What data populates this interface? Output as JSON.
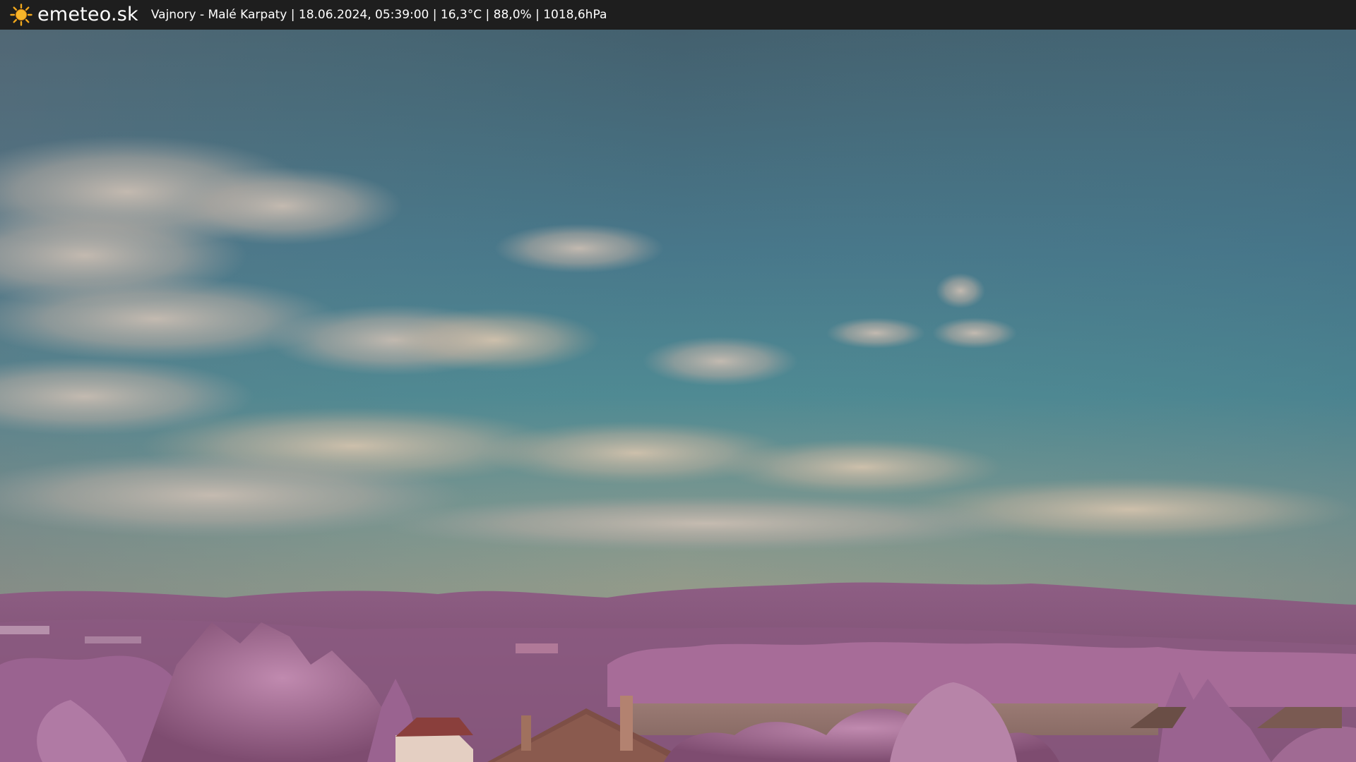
{
  "header": {
    "brand": "emeteo.sk",
    "caption": "Vajnory - Malé Karpaty | 18.06.2024, 05:39:00 | 16,3°C | 88,0% | 1018,6hPa",
    "logo_icon": "sun-icon"
  },
  "colors": {
    "topbar": "#1e1e1e",
    "sun": "#f2a81c",
    "sky_top": "#47606e",
    "sky_mid": "#4b8390",
    "sky_horizon": "#8e9a8a",
    "foliage": "#a56b95",
    "roof": "#8a4f44"
  }
}
